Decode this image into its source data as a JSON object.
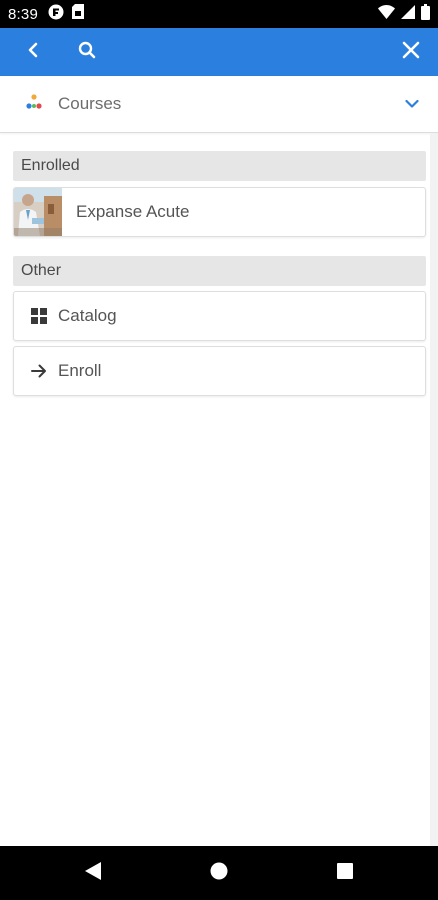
{
  "status_bar": {
    "time": "8:39",
    "left_icons": [
      "gmail-icon",
      "sim-card-icon"
    ],
    "right_icons": [
      "wifi-icon",
      "signal-icon",
      "battery-icon"
    ]
  },
  "app_bar": {
    "color": "#2b7fde",
    "icons": [
      "back-icon",
      "search-icon",
      "close-icon"
    ]
  },
  "courses_header": {
    "title": "Courses",
    "icon": "courses-logo-icon",
    "expand_icon": "chevron-down-icon",
    "accent": "#2b7fde"
  },
  "sections": {
    "enrolled": {
      "title": "Enrolled",
      "items": [
        {
          "label": "Expanse Acute",
          "image": "course-thumbnail"
        }
      ]
    },
    "other": {
      "title": "Other",
      "items": [
        {
          "label": "Catalog",
          "icon": "grid-icon"
        },
        {
          "label": "Enroll",
          "icon": "arrow-right-icon"
        }
      ]
    }
  },
  "nav_bar": {
    "icons": [
      "nav-back-icon",
      "nav-home-icon",
      "nav-recents-icon"
    ]
  }
}
